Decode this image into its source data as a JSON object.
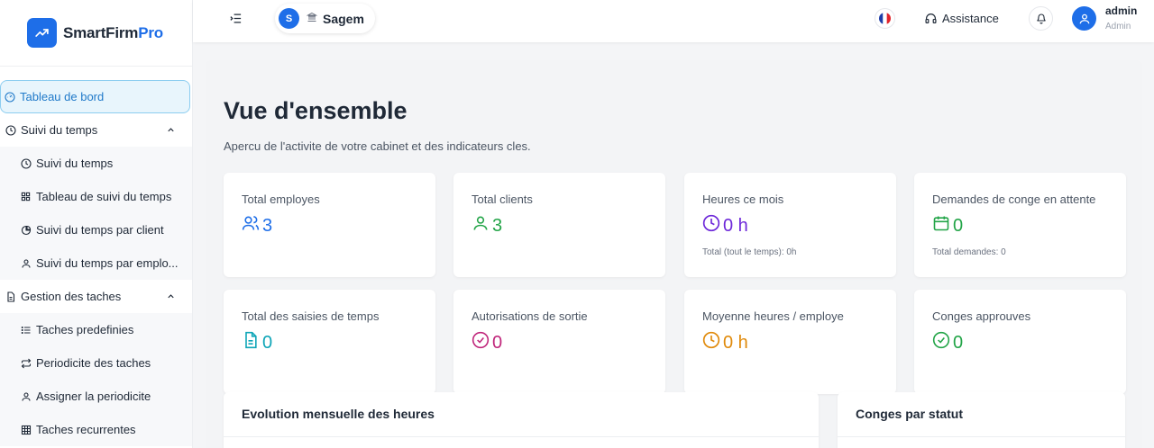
{
  "brand": {
    "name_main": "SmartFirm",
    "name_accent": "Pro",
    "accent": "#1e6ee8"
  },
  "sidebar": {
    "items": [
      {
        "label": "Tableau de bord",
        "icon": "gauge-icon",
        "active": true
      },
      {
        "label": "Suivi du temps",
        "icon": "clock-icon",
        "group": true,
        "expanded": true
      },
      {
        "label": "Suivi du temps",
        "icon": "clock-icon"
      },
      {
        "label": "Tableau de suivi du temps",
        "icon": "grid-icon"
      },
      {
        "label": "Suivi du temps par client",
        "icon": "pie-icon"
      },
      {
        "label": "Suivi du temps par emplo...",
        "icon": "user-icon"
      },
      {
        "label": "Gestion des taches",
        "icon": "document-icon",
        "group": true,
        "expanded": true
      },
      {
        "label": "Taches predefinies",
        "icon": "list-icon"
      },
      {
        "label": "Periodicite des taches",
        "icon": "repeat-icon"
      },
      {
        "label": "Assigner la periodicite",
        "icon": "user-icon"
      },
      {
        "label": "Taches recurrentes",
        "icon": "table-icon"
      }
    ]
  },
  "topbar": {
    "org_initial": "S",
    "org_name": "Sagem",
    "language": "fr",
    "assistance_label": "Assistance",
    "user_name": "admin",
    "user_role": "Admin"
  },
  "page": {
    "title": "Vue d'ensemble",
    "subtitle": "Apercu de l'activite de votre cabinet et des indicateurs cles."
  },
  "cards": [
    {
      "label": "Total employes",
      "value": "3",
      "icon": "users-icon",
      "color": "#1e6ee8"
    },
    {
      "label": "Total clients",
      "value": "3",
      "icon": "user-icon",
      "color": "#22a447"
    },
    {
      "label": "Heures ce mois",
      "value": "0 h",
      "icon": "clock-icon",
      "color": "#6d28d9",
      "note": "Total (tout le temps): 0h"
    },
    {
      "label": "Demandes de conge en attente",
      "value": "0",
      "icon": "calendar-icon",
      "color": "#22a447",
      "note": "Total demandes: 0"
    },
    {
      "label": "Total des saisies de temps",
      "value": "0",
      "icon": "document-icon",
      "color": "#0ea5b7"
    },
    {
      "label": "Autorisations de sortie",
      "value": "0",
      "icon": "check-circle-icon",
      "color": "#c0267b"
    },
    {
      "label": "Moyenne heures / employe",
      "value": "0 h",
      "icon": "clock-icon",
      "color": "#e08a0b"
    },
    {
      "label": "Conges approuves",
      "value": "0",
      "icon": "check-circle-icon",
      "color": "#22a447"
    }
  ],
  "sections": [
    {
      "title": "Evolution mensuelle des heures"
    },
    {
      "title": "Conges par statut"
    }
  ]
}
